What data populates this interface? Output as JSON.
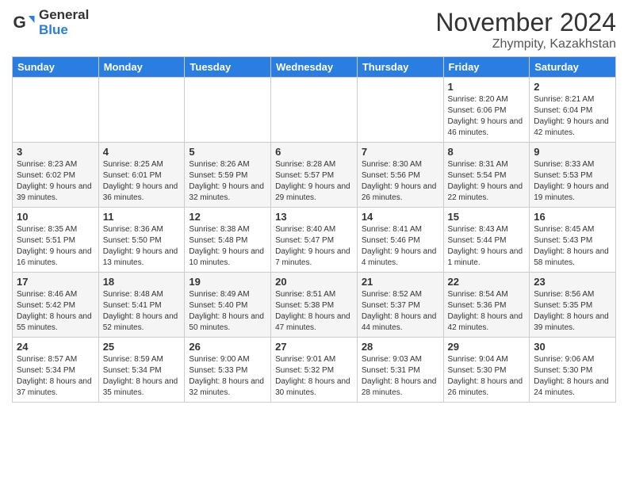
{
  "logo": {
    "general": "General",
    "blue": "Blue"
  },
  "header": {
    "month": "November 2024",
    "location": "Zhympity, Kazakhstan"
  },
  "weekdays": [
    "Sunday",
    "Monday",
    "Tuesday",
    "Wednesday",
    "Thursday",
    "Friday",
    "Saturday"
  ],
  "weeks": [
    [
      {
        "day": "",
        "info": ""
      },
      {
        "day": "",
        "info": ""
      },
      {
        "day": "",
        "info": ""
      },
      {
        "day": "",
        "info": ""
      },
      {
        "day": "",
        "info": ""
      },
      {
        "day": "1",
        "info": "Sunrise: 8:20 AM\nSunset: 6:06 PM\nDaylight: 9 hours and 46 minutes."
      },
      {
        "day": "2",
        "info": "Sunrise: 8:21 AM\nSunset: 6:04 PM\nDaylight: 9 hours and 42 minutes."
      }
    ],
    [
      {
        "day": "3",
        "info": "Sunrise: 8:23 AM\nSunset: 6:02 PM\nDaylight: 9 hours and 39 minutes."
      },
      {
        "day": "4",
        "info": "Sunrise: 8:25 AM\nSunset: 6:01 PM\nDaylight: 9 hours and 36 minutes."
      },
      {
        "day": "5",
        "info": "Sunrise: 8:26 AM\nSunset: 5:59 PM\nDaylight: 9 hours and 32 minutes."
      },
      {
        "day": "6",
        "info": "Sunrise: 8:28 AM\nSunset: 5:57 PM\nDaylight: 9 hours and 29 minutes."
      },
      {
        "day": "7",
        "info": "Sunrise: 8:30 AM\nSunset: 5:56 PM\nDaylight: 9 hours and 26 minutes."
      },
      {
        "day": "8",
        "info": "Sunrise: 8:31 AM\nSunset: 5:54 PM\nDaylight: 9 hours and 22 minutes."
      },
      {
        "day": "9",
        "info": "Sunrise: 8:33 AM\nSunset: 5:53 PM\nDaylight: 9 hours and 19 minutes."
      }
    ],
    [
      {
        "day": "10",
        "info": "Sunrise: 8:35 AM\nSunset: 5:51 PM\nDaylight: 9 hours and 16 minutes."
      },
      {
        "day": "11",
        "info": "Sunrise: 8:36 AM\nSunset: 5:50 PM\nDaylight: 9 hours and 13 minutes."
      },
      {
        "day": "12",
        "info": "Sunrise: 8:38 AM\nSunset: 5:48 PM\nDaylight: 9 hours and 10 minutes."
      },
      {
        "day": "13",
        "info": "Sunrise: 8:40 AM\nSunset: 5:47 PM\nDaylight: 9 hours and 7 minutes."
      },
      {
        "day": "14",
        "info": "Sunrise: 8:41 AM\nSunset: 5:46 PM\nDaylight: 9 hours and 4 minutes."
      },
      {
        "day": "15",
        "info": "Sunrise: 8:43 AM\nSunset: 5:44 PM\nDaylight: 9 hours and 1 minute."
      },
      {
        "day": "16",
        "info": "Sunrise: 8:45 AM\nSunset: 5:43 PM\nDaylight: 8 hours and 58 minutes."
      }
    ],
    [
      {
        "day": "17",
        "info": "Sunrise: 8:46 AM\nSunset: 5:42 PM\nDaylight: 8 hours and 55 minutes."
      },
      {
        "day": "18",
        "info": "Sunrise: 8:48 AM\nSunset: 5:41 PM\nDaylight: 8 hours and 52 minutes."
      },
      {
        "day": "19",
        "info": "Sunrise: 8:49 AM\nSunset: 5:40 PM\nDaylight: 8 hours and 50 minutes."
      },
      {
        "day": "20",
        "info": "Sunrise: 8:51 AM\nSunset: 5:38 PM\nDaylight: 8 hours and 47 minutes."
      },
      {
        "day": "21",
        "info": "Sunrise: 8:52 AM\nSunset: 5:37 PM\nDaylight: 8 hours and 44 minutes."
      },
      {
        "day": "22",
        "info": "Sunrise: 8:54 AM\nSunset: 5:36 PM\nDaylight: 8 hours and 42 minutes."
      },
      {
        "day": "23",
        "info": "Sunrise: 8:56 AM\nSunset: 5:35 PM\nDaylight: 8 hours and 39 minutes."
      }
    ],
    [
      {
        "day": "24",
        "info": "Sunrise: 8:57 AM\nSunset: 5:34 PM\nDaylight: 8 hours and 37 minutes."
      },
      {
        "day": "25",
        "info": "Sunrise: 8:59 AM\nSunset: 5:34 PM\nDaylight: 8 hours and 35 minutes."
      },
      {
        "day": "26",
        "info": "Sunrise: 9:00 AM\nSunset: 5:33 PM\nDaylight: 8 hours and 32 minutes."
      },
      {
        "day": "27",
        "info": "Sunrise: 9:01 AM\nSunset: 5:32 PM\nDaylight: 8 hours and 30 minutes."
      },
      {
        "day": "28",
        "info": "Sunrise: 9:03 AM\nSunset: 5:31 PM\nDaylight: 8 hours and 28 minutes."
      },
      {
        "day": "29",
        "info": "Sunrise: 9:04 AM\nSunset: 5:30 PM\nDaylight: 8 hours and 26 minutes."
      },
      {
        "day": "30",
        "info": "Sunrise: 9:06 AM\nSunset: 5:30 PM\nDaylight: 8 hours and 24 minutes."
      }
    ]
  ]
}
